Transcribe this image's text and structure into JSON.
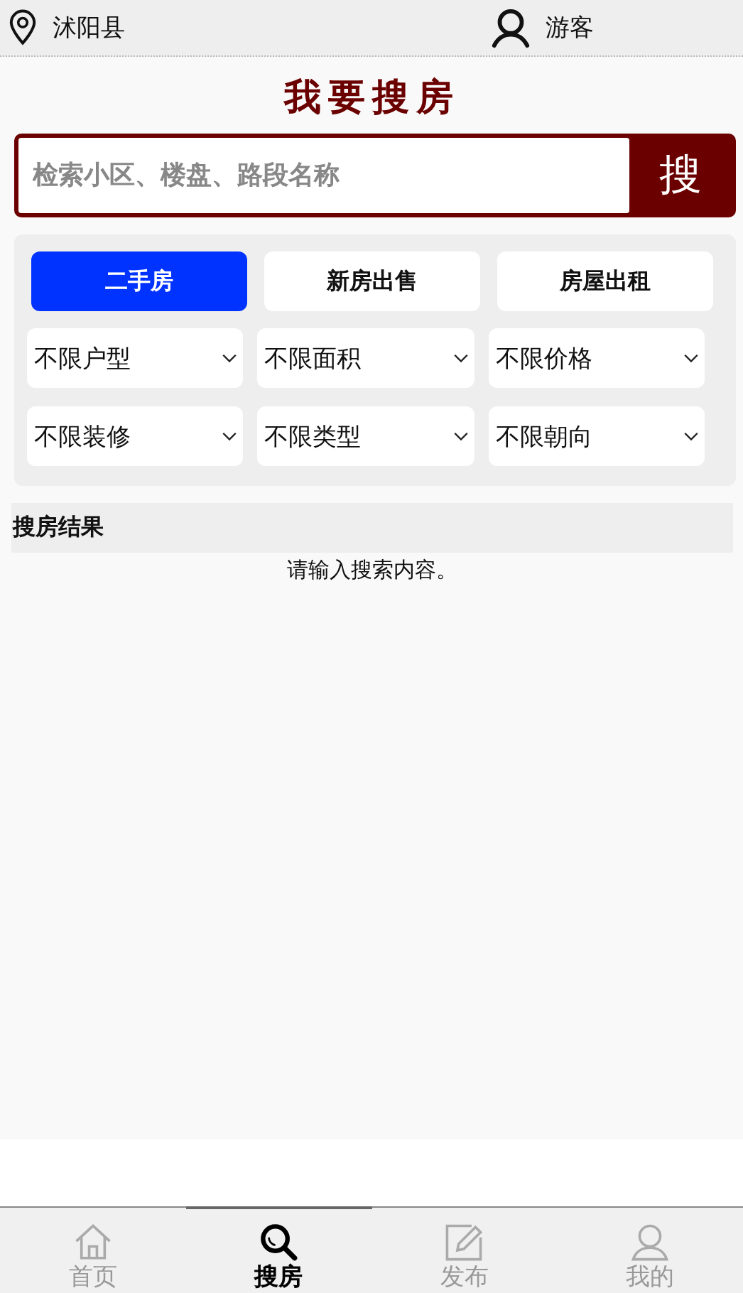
{
  "header": {
    "location": "沭阳县",
    "user": "游客"
  },
  "title": "我要搜房",
  "search": {
    "placeholder": "检索小区、楼盘、路段名称",
    "button": "搜"
  },
  "tabs": [
    {
      "label": "二手房",
      "selected": true
    },
    {
      "label": "新房出售",
      "selected": false
    },
    {
      "label": "房屋出租",
      "selected": false
    }
  ],
  "filters": [
    {
      "value": "不限户型"
    },
    {
      "value": "不限面积"
    },
    {
      "value": "不限价格"
    },
    {
      "value": "不限装修"
    },
    {
      "value": "不限类型"
    },
    {
      "value": "不限朝向"
    }
  ],
  "results": {
    "heading": "搜房结果",
    "message": "请输入搜索内容。"
  },
  "nav": [
    {
      "kind": "home",
      "label": "首页",
      "selected": false
    },
    {
      "kind": "search",
      "label": "搜房",
      "selected": true
    },
    {
      "kind": "edit",
      "label": "发布",
      "selected": false
    },
    {
      "kind": "user",
      "label": "我的",
      "selected": false
    }
  ]
}
